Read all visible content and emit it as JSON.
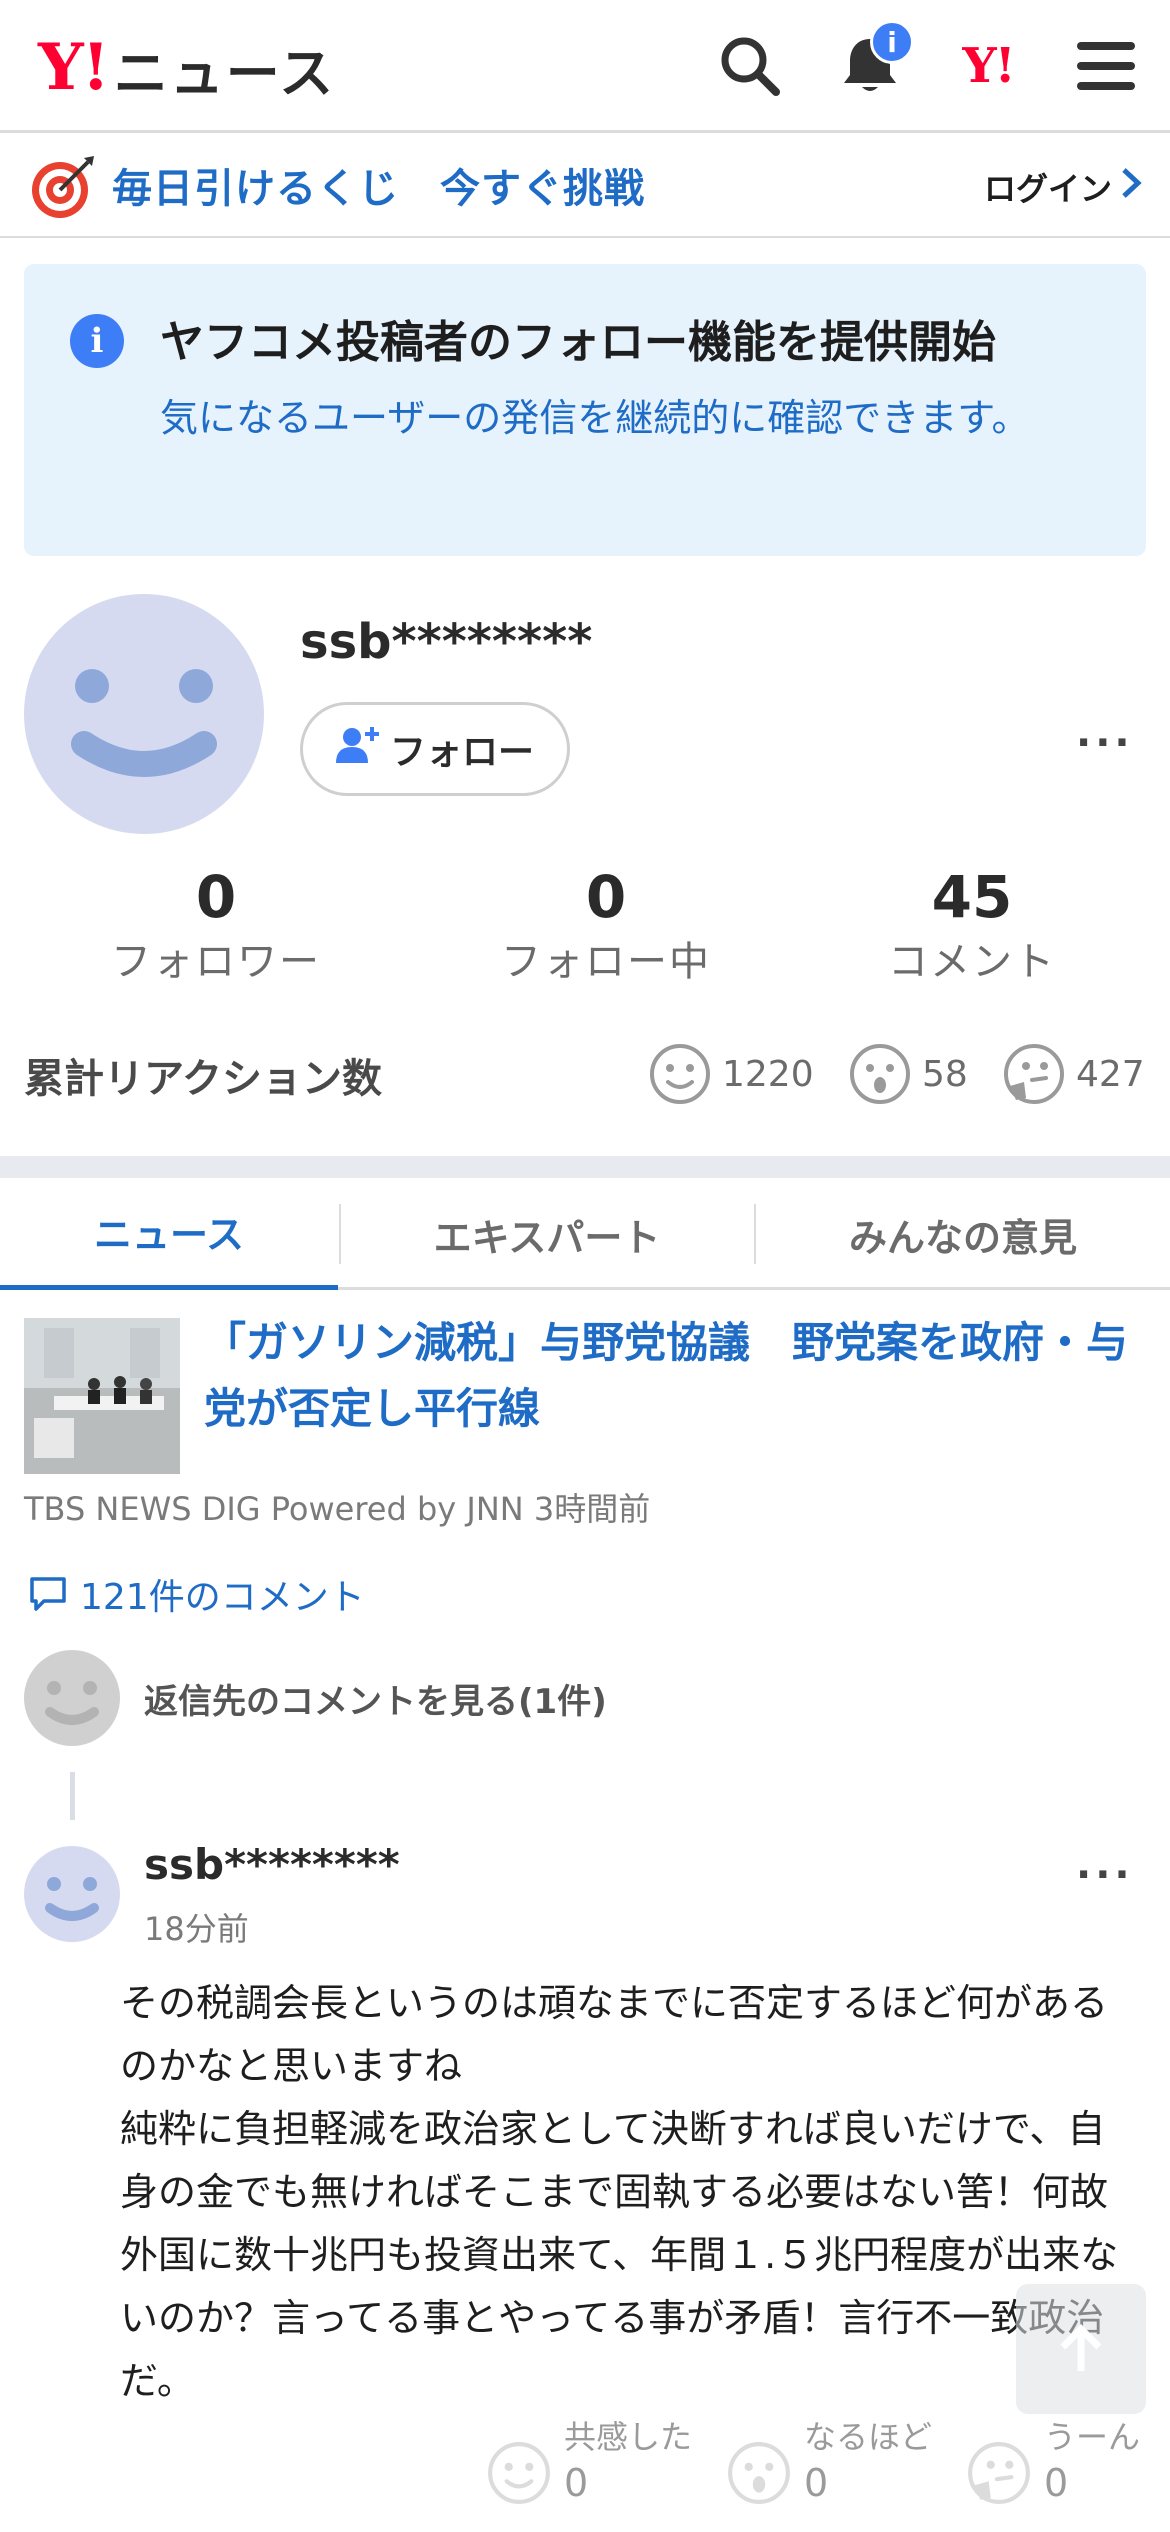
{
  "header": {
    "logo_mark": "Y!",
    "logo_text": "ニュース",
    "notification_badge": "i",
    "icons": [
      "search-icon",
      "bell-icon",
      "yahoo-japan-icon",
      "hamburger-menu-icon"
    ]
  },
  "lottery": {
    "text": "毎日引けるくじ　今すぐ挑戦",
    "login_label": "ログイン",
    "icon": "target-icon"
  },
  "notice": {
    "icon": "info-icon",
    "title": "ヤフコメ投稿者のフォロー機能を提供開始",
    "body": "気になるユーザーの発信を継続的に確認できます。"
  },
  "profile": {
    "username": "ssb********",
    "follow_label": "フォロー",
    "more_label": "···",
    "stats": [
      {
        "value": "0",
        "label": "フォロワー"
      },
      {
        "value": "0",
        "label": "フォロー中"
      },
      {
        "value": "45",
        "label": "コメント"
      }
    ],
    "reactions_label": "累計リアクション数",
    "reactions": [
      {
        "icon": "smile-face-icon",
        "count": "1220"
      },
      {
        "icon": "surprised-face-icon",
        "count": "58"
      },
      {
        "icon": "thinking-face-icon",
        "count": "427"
      }
    ]
  },
  "tabs": [
    {
      "label": "ニュース",
      "active": true
    },
    {
      "label": "エキスパート",
      "active": false
    },
    {
      "label": "みんなの意見",
      "active": false
    }
  ],
  "article": {
    "title": "「ガソリン減税」与野党協議　野党案を政府・与党が否定し平行線",
    "source": "TBS NEWS DIG Powered by JNN 3時間前",
    "comment_count": "121件のコメント"
  },
  "reply": {
    "label": "返信先のコメントを見る(1件)"
  },
  "comment": {
    "username": "ssb********",
    "time": "18分前",
    "body": "その税調会長というのは頑なまでに否定するほど何があるのかなと思いますね\n純粋に負担軽減を政治家として決断すれば良いだけで、自身の金でも無ければそこまで固執する必要はない筈！何故外国に数十兆円も投資出来て、年間１.５兆円程度が出来ないのか？言ってる事とやってる事が矛盾！言行不一致政治だ。",
    "reactions": [
      {
        "label": "共感した",
        "count": "0"
      },
      {
        "label": "なるほど",
        "count": "0"
      },
      {
        "label": "うーん",
        "count": "0"
      }
    ]
  },
  "colors": {
    "accent": "#1f6cc6",
    "brand": "#ff0033",
    "notice_bg": "#e6f2fc",
    "badge": "#3d7ef7"
  }
}
